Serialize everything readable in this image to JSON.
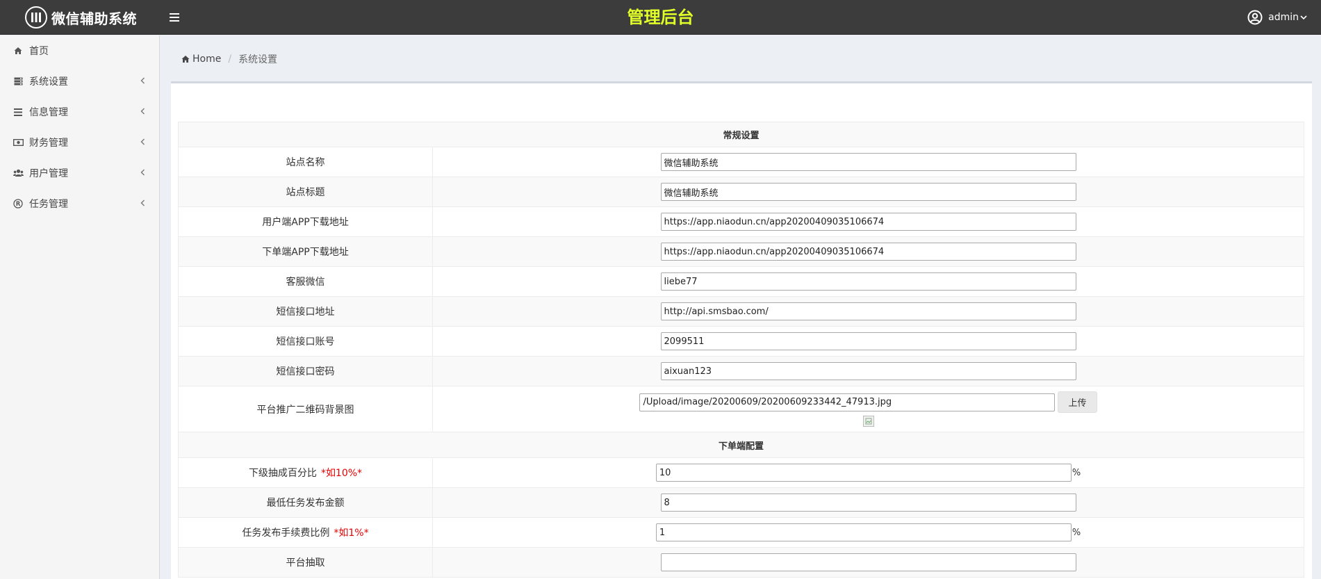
{
  "header": {
    "brand_title": "微信辅助系统",
    "center_title": "管理后台",
    "user_name": "admin",
    "center_title_color": "#e2ff28"
  },
  "sidebar": {
    "items": [
      {
        "label": "首页",
        "icon": "home-icon"
      },
      {
        "label": "系统设置",
        "icon": "server-icon"
      },
      {
        "label": "信息管理",
        "icon": "list-icon"
      },
      {
        "label": "财务管理",
        "icon": "money-icon"
      },
      {
        "label": "用户管理",
        "icon": "users-icon"
      },
      {
        "label": "任务管理",
        "icon": "registered-icon"
      }
    ]
  },
  "breadcrumb": {
    "home": "Home",
    "current": "系统设置"
  },
  "settings": {
    "section_general": "常规设置",
    "site_name": {
      "label": "站点名称",
      "value": "微信辅助系统"
    },
    "site_title": {
      "label": "站点标题",
      "value": "微信辅助系统"
    },
    "user_app_url": {
      "label": "用户端APP下载地址",
      "value": "https://app.niaodun.cn/app20200409035106674"
    },
    "order_app_url": {
      "label": "下单端APP下载地址",
      "value": "https://app.niaodun.cn/app20200409035106674"
    },
    "service_wechat": {
      "label": "客服微信",
      "value": "liebe77"
    },
    "sms_api_url": {
      "label": "短信接口地址",
      "value": "http://api.smsbao.com/"
    },
    "sms_account": {
      "label": "短信接口账号",
      "value": "2099511"
    },
    "sms_password": {
      "label": "短信接口密码",
      "value": "aixuan123"
    },
    "qrcode_bg": {
      "label": "平台推广二维码背景图",
      "value": "/Upload/image/20200609/20200609233442_47913.jpg",
      "upload_label": "上传"
    },
    "section_order": "下单端配置",
    "sub_commission": {
      "label": "下级抽成百分比",
      "hint": "*如10%*",
      "value": "10",
      "unit": "%"
    },
    "min_task_amount": {
      "label": "最低任务发布金额",
      "value": "8"
    },
    "task_fee_ratio": {
      "label": "任务发布手续费比例",
      "hint": "*如1%*",
      "value": "1",
      "unit": "%"
    },
    "platform_cut": {
      "label": "平台抽取",
      "value": ""
    }
  }
}
